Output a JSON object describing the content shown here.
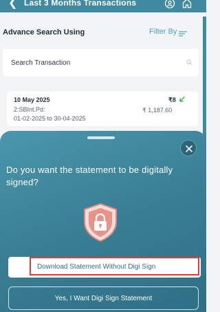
{
  "header": {
    "title": "Last 3 Months Transactions",
    "back_icon": "chevron-left-icon",
    "icons": [
      "user-circle-icon",
      "home-icon"
    ]
  },
  "search_section": {
    "label": "Advance Search Using",
    "filter_label": "Filter By",
    "search_placeholder": "Search Transaction"
  },
  "transaction": {
    "date": "10 May 2025",
    "description": "2:SBInt.Pd:",
    "period": "01-02-2025 to 30-04-2025",
    "small_amount": "₹8",
    "amount": "₹ 1,187.60",
    "direction_icon": "arrow-down-left-icon"
  },
  "sheet": {
    "question": "Do you want the statement to be digitally signed?",
    "download_without_label": "Download Statement Without Digi Sign",
    "digi_sign_label": "Yes, I Want Digi Sign Statement",
    "close_icon": "close-icon",
    "illustration_icon": "shield-lock-icon"
  },
  "colors": {
    "accent": "#3f8aa0",
    "link": "#4aa3c0",
    "highlight": "#e53935",
    "credit_arrow": "#3bb54a"
  }
}
